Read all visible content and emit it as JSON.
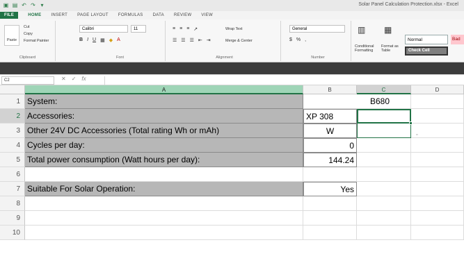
{
  "window": {
    "title": "Solar Panel Calculation Protection.xlsx - Excel",
    "qat_icons": [
      "excel-icon",
      "save-icon",
      "undo-icon",
      "redo-icon",
      "customize-icon"
    ]
  },
  "ribbon_tabs": [
    {
      "label": "FILE"
    },
    {
      "label": "HOME"
    },
    {
      "label": "INSERT"
    },
    {
      "label": "PAGE LAYOUT"
    },
    {
      "label": "FORMULAS"
    },
    {
      "label": "DATA"
    },
    {
      "label": "REVIEW"
    },
    {
      "label": "VIEW"
    }
  ],
  "ribbon": {
    "clipboard": {
      "paste": "Paste",
      "cut": "Cut",
      "copy": "Copy",
      "format_painter": "Format Painter",
      "label": "Clipboard"
    },
    "font": {
      "name": "Calibri",
      "size": "11",
      "bold": "B",
      "italic": "I",
      "underline": "U",
      "label": "Font"
    },
    "alignment": {
      "wrap_text": "Wrap Text",
      "merge": "Merge & Center",
      "label": "Alignment"
    },
    "number": {
      "format": "General",
      "currency": "$",
      "percent": "%",
      "comma": ",",
      "label": "Number"
    },
    "styles": {
      "conditional": "Conditional Formatting",
      "format_table": "Format as Table",
      "normal": "Normal",
      "check_cell": "Check Cell",
      "bad": "Bad"
    }
  },
  "formula_bar": {
    "name_box": "C2",
    "cancel": "✕",
    "enter": "✓",
    "fx": "fx",
    "value": ""
  },
  "columns": [
    "A",
    "B",
    "C",
    "D"
  ],
  "rows": [
    "1",
    "2",
    "3",
    "4",
    "5",
    "6",
    "7",
    "8",
    "9",
    "10"
  ],
  "cells": {
    "a1": "System:",
    "b1": "B680",
    "a2": "Accessories:",
    "b2": "XP 308",
    "a3": "Other 24V DC Accessories (Total rating Wh or mAh)",
    "b3": "W",
    "a4": "Cycles per day:",
    "b4": "0",
    "a5": "Total power consumption (Watt hours per day):",
    "b5": "144.24",
    "a7": "Suitable For Solar Operation:",
    "b7": "Yes"
  },
  "colors": {
    "accent": "#217346",
    "selected_header": "#9fd5b7",
    "label_fill": "#b7b7b7"
  }
}
